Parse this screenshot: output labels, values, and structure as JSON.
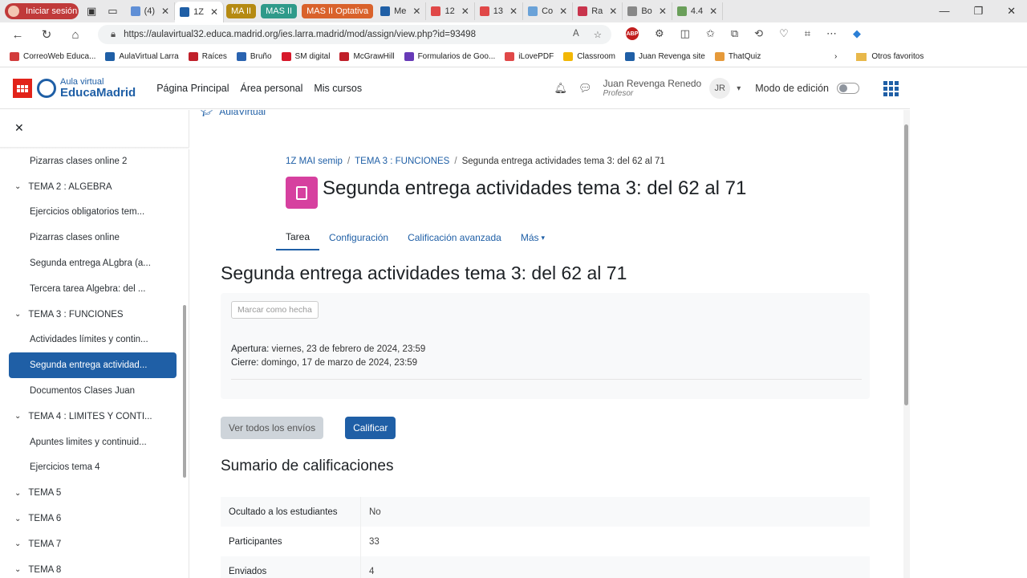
{
  "browser": {
    "signin_label": "Iniciar sesión",
    "tabs": [
      {
        "label": "(4)",
        "color": "#5f8fd6"
      },
      {
        "label": "1Z",
        "color": "#1f5fa6",
        "active": true
      },
      {
        "label": "Me",
        "color": "#1f5fa6"
      },
      {
        "label": "12",
        "color": "#e04848"
      },
      {
        "label": "13",
        "color": "#e04848"
      },
      {
        "label": "Co",
        "color": "#6aa2d8"
      },
      {
        "label": "Ra",
        "color": "#c8344c"
      },
      {
        "label": "Bo",
        "color": "#888888"
      },
      {
        "label": "4.4",
        "color": "#6a9f5a"
      }
    ],
    "groups": [
      {
        "label": "MA II",
        "color": "#b58a12"
      },
      {
        "label": "MAS II",
        "color": "#2f9a8a"
      },
      {
        "label": "MAS II Optativa",
        "color": "#d9622b"
      }
    ],
    "url": "https://aulavirtual32.educa.madrid.org/ies.larra.madrid/mod/assign/view.php?id=93498",
    "bookmarks": [
      {
        "label": "CorreoWeb Educa...",
        "color": "#d23c3c"
      },
      {
        "label": "AulaVirtual Larra",
        "color": "#1f5fa6"
      },
      {
        "label": "Raíces",
        "color": "#c0202a"
      },
      {
        "label": "Bruño",
        "color": "#2a63b0"
      },
      {
        "label": "SM digital",
        "color": "#d7182a"
      },
      {
        "label": "McGrawHill",
        "color": "#c0202a"
      },
      {
        "label": "Formularios de Goo...",
        "color": "#673ab7"
      },
      {
        "label": "iLovePDF",
        "color": "#e04848"
      },
      {
        "label": "Classroom",
        "color": "#f2b705"
      },
      {
        "label": "Juan Revenga site",
        "color": "#1f5fa6"
      },
      {
        "label": "ThatQuiz",
        "color": "#e69a3a"
      }
    ],
    "other_favorites": "Otros favoritos"
  },
  "header": {
    "logo_line1": "Aula virtual",
    "logo_line2": "EducaMadrid",
    "nav": [
      "Página Principal",
      "Área personal",
      "Mis cursos"
    ],
    "user_name": "Juan Revenga Renedo",
    "user_role": "Profesor",
    "user_initials": "JR",
    "edit_mode_label": "Modo de edición"
  },
  "drawer": {
    "items": [
      {
        "label": "Pizarras clases online 2",
        "type": "sub"
      },
      {
        "label": "TEMA 2 : ALGEBRA",
        "type": "sec"
      },
      {
        "label": "Ejercicios obligatorios tem...",
        "type": "sub"
      },
      {
        "label": "Pizarras clases online",
        "type": "sub"
      },
      {
        "label": "Segunda entrega ALgbra (a...",
        "type": "sub"
      },
      {
        "label": "Tercera tarea Algebra: del ...",
        "type": "sub"
      },
      {
        "label": "TEMA 3 : FUNCIONES",
        "type": "sec"
      },
      {
        "label": "Actividades límites y contin...",
        "type": "sub"
      },
      {
        "label": "Segunda entrega actividad...",
        "type": "act"
      },
      {
        "label": "Documentos Clases Juan",
        "type": "sub"
      },
      {
        "label": "TEMA 4 : LIMITES Y CONTI...",
        "type": "sec"
      },
      {
        "label": "Apuntes limites y continuid...",
        "type": "sub"
      },
      {
        "label": "Ejercicios tema 4",
        "type": "sub"
      },
      {
        "label": "TEMA 5",
        "type": "sec"
      },
      {
        "label": "TEMA 6",
        "type": "sec"
      },
      {
        "label": "TEMA 7",
        "type": "sec"
      },
      {
        "label": "TEMA 8",
        "type": "sec"
      }
    ]
  },
  "main": {
    "top_link": "AulaVirtual",
    "breadcrumb": [
      "1Z MAI semip",
      "TEMA 3 : FUNCIONES",
      "Segunda entrega actividades tema 3: del 62 al 71"
    ],
    "page_title": "Segunda entrega actividades tema 3: del 62 al 71",
    "tabs": [
      "Tarea",
      "Configuración",
      "Calificación avanzada",
      "Más"
    ],
    "heading": "Segunda entrega actividades tema 3: del 62 al 71",
    "mark_done_label": "Marcar como hecha",
    "opening_label": "Apertura:",
    "opening_value": "viernes, 23 de febrero de 2024, 23:59",
    "closing_label": "Cierre:",
    "closing_value": "domingo, 17 de marzo de 2024, 23:59",
    "view_all_label": "Ver todos los envíos",
    "grade_label": "Calificar",
    "summary_title": "Sumario de calificaciones",
    "summary_rows": [
      {
        "key": "Ocultado a los estudiantes",
        "value": "No"
      },
      {
        "key": "Participantes",
        "value": "33"
      },
      {
        "key": "Enviados",
        "value": "4"
      }
    ]
  }
}
